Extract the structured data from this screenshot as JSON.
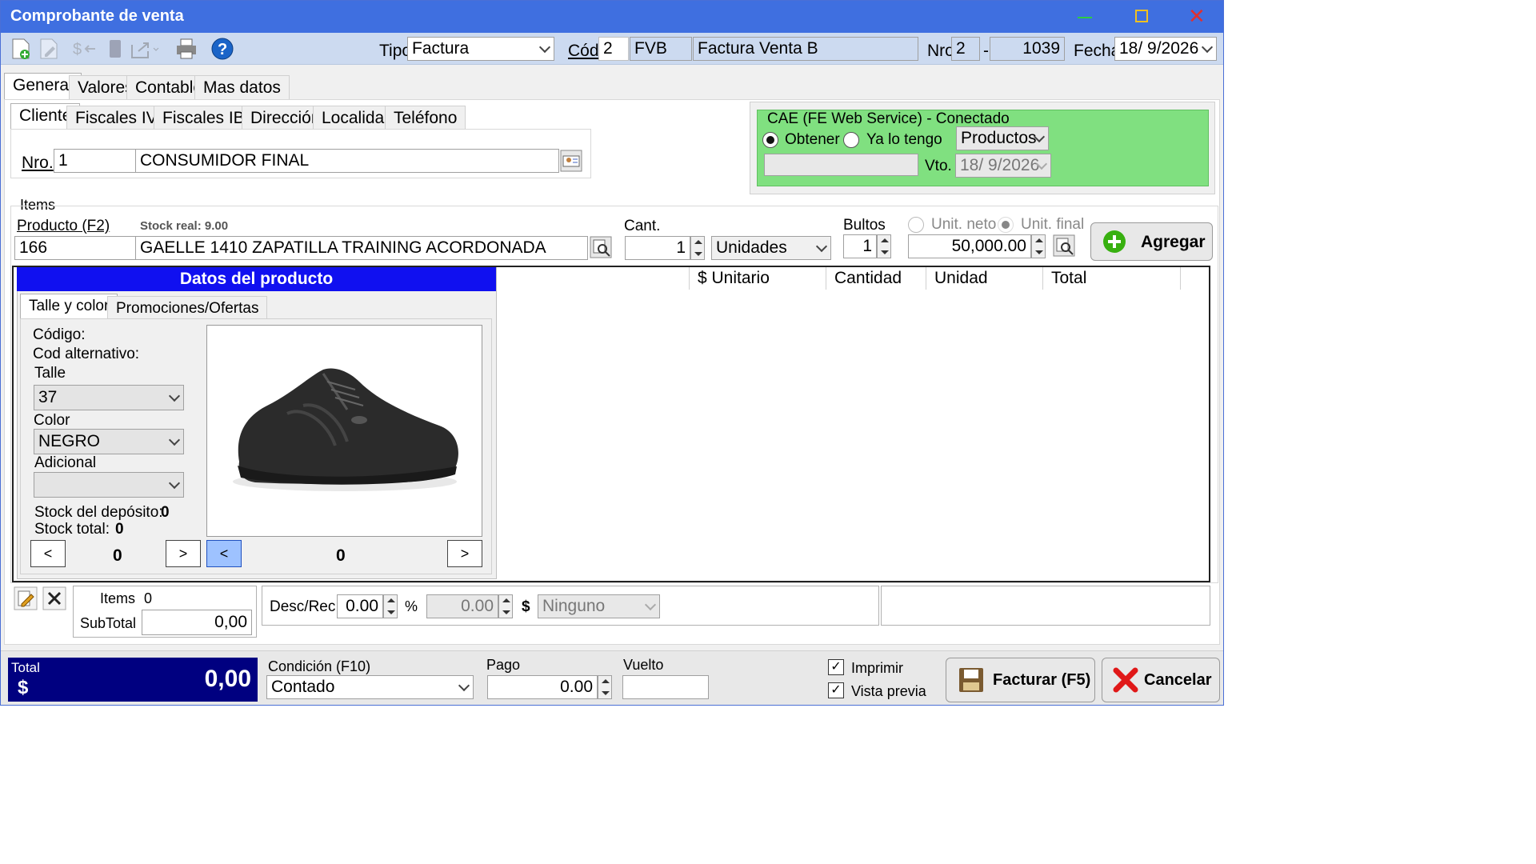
{
  "window": {
    "title": "Comprobante de venta"
  },
  "header": {
    "tipo_label": "Tipo",
    "tipo_value": "Factura",
    "cod_label": "Cód.",
    "cod_value": "2",
    "cod_code": "FVB",
    "cod_desc": "Factura Venta B",
    "nro_label": "Nro",
    "nro_pv": "2",
    "nro_sep": "-",
    "nro_num": "1039",
    "fecha_label": "Fecha",
    "fecha_value": "18/ 9/2026"
  },
  "tabs": [
    "General",
    "Valores",
    "Contable",
    "Mas datos"
  ],
  "client_tabs": [
    "Cliente",
    "Fiscales IVA",
    "Fiscales IBR",
    "Dirección",
    "Localidad",
    "Teléfono"
  ],
  "client": {
    "nro_label": "Nro.",
    "nro_value": "1",
    "name": "CONSUMIDOR FINAL"
  },
  "cae": {
    "title": "CAE (FE Web Service) - Conectado",
    "obtener": "Obtener",
    "ya_lo_tengo": "Ya lo tengo",
    "productos": "Productos",
    "vto_label": "Vto.",
    "vto_value": "18/ 9/2026",
    "selected": "Obtener"
  },
  "items": {
    "section_label": "Items",
    "producto_label": "Producto (F2)",
    "stock_real": "Stock real: 9.00",
    "producto_code": "166",
    "producto_desc": "GAELLE 1410 ZAPATILLA TRAINING ACORDONADA",
    "cant_label": "Cant.",
    "cant_value": "1",
    "unidad_value": "Unidades",
    "bultos_label": "Bultos",
    "bultos_value": "1",
    "unit_neto": "Unit. neto",
    "unit_final": "Unit. final",
    "precio_value": "50,000.00",
    "agregar": "Agregar"
  },
  "product_panel": {
    "title": "Datos del producto",
    "tabs": [
      "Talle y color",
      "Promociones/Ofertas"
    ],
    "codigo_label": "Código:",
    "cod_alt_label": "Cod alternativo:",
    "talle_label": "Talle",
    "talle_value": "37",
    "color_label": "Color",
    "color_value": "NEGRO",
    "adicional_label": "Adicional",
    "adicional_value": "",
    "stock_deposito_label": "Stock del depósito:",
    "stock_deposito_value": "0",
    "stock_total_label": "Stock total:",
    "stock_total_value": "0",
    "nav_left_count": "0",
    "nav_right_count": "0",
    "prev": "<",
    "next": ">"
  },
  "grid": {
    "columns": [
      "$ Unitario",
      "Cantidad",
      "Unidad",
      "Total"
    ]
  },
  "subtotal": {
    "items_label": "Items",
    "items_value": "0",
    "subtotal_label": "SubTotal",
    "subtotal_value": "0,00",
    "desc_rec_label": "Desc/Rec",
    "pct_value": "0.00",
    "pct_sign": "%",
    "amount_value": "0.00",
    "amount_sign": "$",
    "ninguno": "Ninguno"
  },
  "footer": {
    "total_label": "Total",
    "currency": "$",
    "total_value": "0,00",
    "condicion_label": "Condición (F10)",
    "condicion_value": "Contado",
    "pago_label": "Pago",
    "pago_value": "0.00",
    "vuelto_label": "Vuelto",
    "vuelto_value": "",
    "imprimir": "Imprimir",
    "vista_previa": "Vista previa",
    "facturar": "Facturar (F5)",
    "cancelar": "Cancelar"
  },
  "colors": {
    "titlebar": "#3f6fe0",
    "toolbar": "#ccdaf0",
    "cae_bg": "#80e080",
    "product_header": "#1010f0",
    "total_bg": "#000080"
  }
}
